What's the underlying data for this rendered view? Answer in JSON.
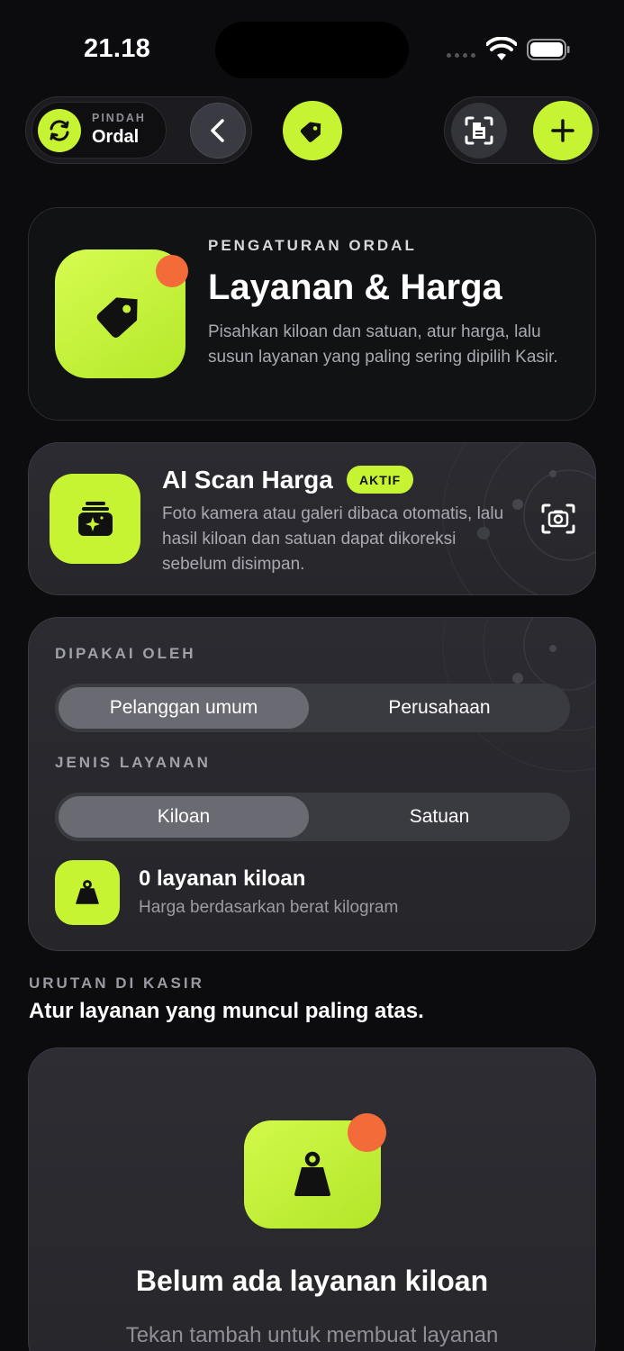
{
  "status_bar": {
    "time": "21.18"
  },
  "toolbar": {
    "switch_small": "PINDAH",
    "switch_main": "Ordal",
    "icons": [
      "sync-icon",
      "chevron-left-icon",
      "tag-icon",
      "scan-document-icon",
      "plus-icon"
    ]
  },
  "hero": {
    "eyebrow": "PENGATURAN ORDAL",
    "title": "Layanan & Harga",
    "description": "Pisahkan kiloan dan satuan, atur harga, lalu susun layanan yang paling sering dipilih Kasir."
  },
  "ai_scan": {
    "title": "AI Scan Harga",
    "badge": "AKTIF",
    "description": "Foto kamera atau galeri dibaca otomatis, lalu hasil kiloan dan satuan dapat dikoreksi sebelum disimpan."
  },
  "filters": {
    "used_by_label": "DIPAKAI OLEH",
    "used_by_options": [
      "Pelanggan umum",
      "Perusahaan"
    ],
    "used_by_selected": "Pelanggan umum",
    "type_label": "JENIS LAYANAN",
    "type_options": [
      "Kiloan",
      "Satuan"
    ],
    "type_selected": "Kiloan",
    "summary_title": "0 layanan kiloan",
    "summary_sub": "Harga berdasarkan berat kilogram"
  },
  "order_section": {
    "caption": "URUTAN DI KASIR",
    "title": "Atur layanan yang muncul paling atas."
  },
  "empty_state": {
    "title": "Belum ada layanan kiloan",
    "subtitle": "Tekan tambah untuk membuat layanan"
  },
  "colors": {
    "accent": "#c6f432",
    "notification": "#f26b38",
    "background": "#0c0c0f",
    "card": "#2b2b31"
  }
}
